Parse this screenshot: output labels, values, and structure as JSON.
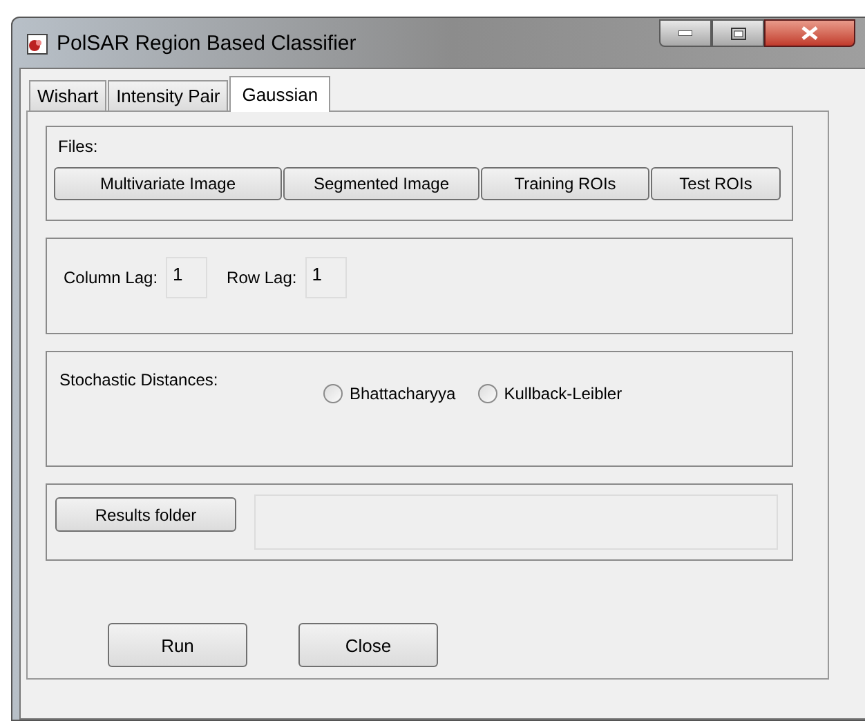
{
  "window": {
    "title": "PolSAR Region Based Classifier"
  },
  "tabs": [
    {
      "label": "Wishart",
      "selected": false
    },
    {
      "label": "Intensity Pair",
      "selected": false
    },
    {
      "label": "Gaussian",
      "selected": true
    }
  ],
  "files": {
    "label": "Files:",
    "buttons": [
      "Multivariate Image",
      "Segmented Image",
      "Training ROIs",
      "Test ROIs"
    ]
  },
  "lags": [
    {
      "label": "Column Lag:",
      "value": "1"
    },
    {
      "label": "Row Lag:",
      "value": "1"
    }
  ],
  "distances": {
    "label": "Stochastic Distances:",
    "options": [
      {
        "label": "Bhattacharyya",
        "selected": false
      },
      {
        "label": "Kullback-Leibler",
        "selected": false
      }
    ]
  },
  "results": {
    "button": "Results folder"
  },
  "buttons": [
    "Run",
    "Close"
  ]
}
